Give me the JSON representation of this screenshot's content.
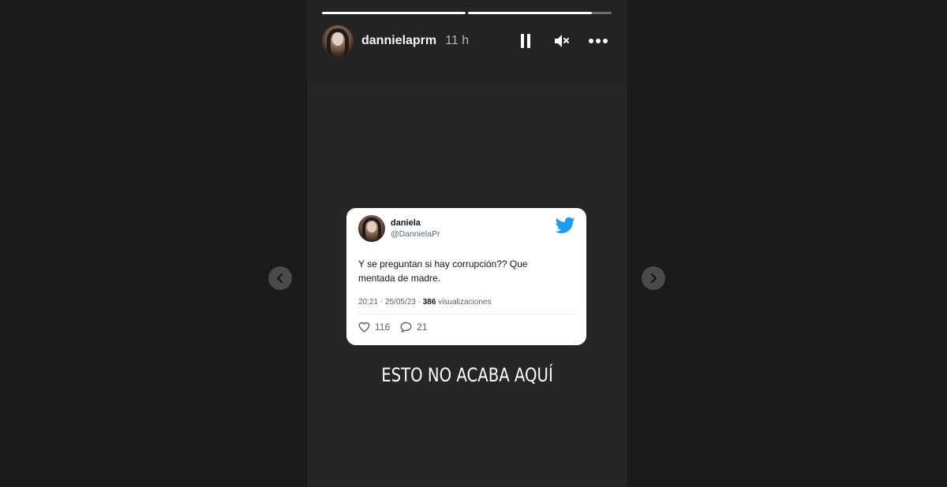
{
  "story": {
    "progress": [
      1.0,
      0.86
    ],
    "user": {
      "username": "dannielaprm",
      "time_ago": "11 h"
    },
    "controls": {
      "pause_icon": "pause-icon",
      "mute_icon": "muted-speaker-icon",
      "more_icon": "ellipsis-icon"
    },
    "caption": "ESTO NO ACABA AQUÍ"
  },
  "tweet": {
    "name": "daniela",
    "handle": "@DannielaPr",
    "text": "Y se preguntan si hay corrupción?? Que mentada de madre.",
    "meta_time": "20:21 · 25/05/23 · ",
    "views_count": "386",
    "views_label": " visualizaciones",
    "likes": "116",
    "replies": "21",
    "brand_color": "#1d9bf0"
  },
  "nav": {
    "prev_icon": "chevron-left-icon",
    "next_icon": "chevron-right-icon"
  },
  "colors": {
    "page_bg": "#1a1a1a",
    "story_bg": "#262626",
    "card_bg": "#ffffff"
  }
}
